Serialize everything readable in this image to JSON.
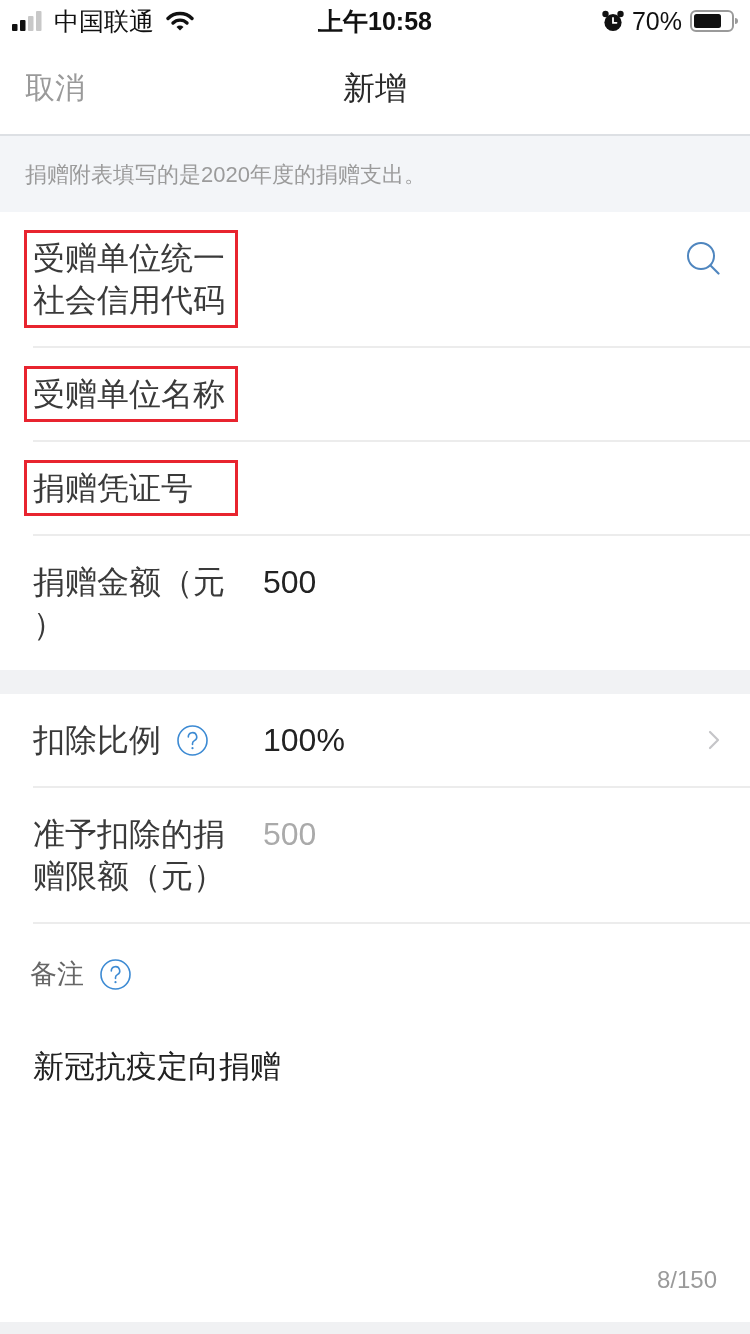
{
  "status_bar": {
    "carrier": "中国联通",
    "time": "上午10:58",
    "battery_percent": "70%"
  },
  "nav": {
    "cancel": "取消",
    "title": "新增"
  },
  "notice": "捐赠附表填写的是2020年度的捐赠支出。",
  "sections": [
    {
      "fields": [
        {
          "kind": "search",
          "label": "受赠单位统一社会信用代码",
          "highlighted": true
        },
        {
          "kind": "text",
          "label": "受赠单位名称",
          "highlighted": true
        },
        {
          "kind": "text",
          "label": "捐赠凭证号",
          "highlighted": true
        },
        {
          "kind": "text",
          "label": "捐赠金额（元）",
          "value": "500",
          "highlighted": false
        }
      ]
    },
    {
      "fields": [
        {
          "kind": "select",
          "label": "扣除比例",
          "help": true,
          "value": "100%",
          "highlighted": false
        },
        {
          "kind": "readonly",
          "label": "准予扣除的捐赠限额（元）",
          "value": "500",
          "highlighted": false
        }
      ]
    }
  ],
  "remark": {
    "label": "备注",
    "help": true,
    "value": "新冠抗疫定向捐赠",
    "counter": "8/150"
  }
}
